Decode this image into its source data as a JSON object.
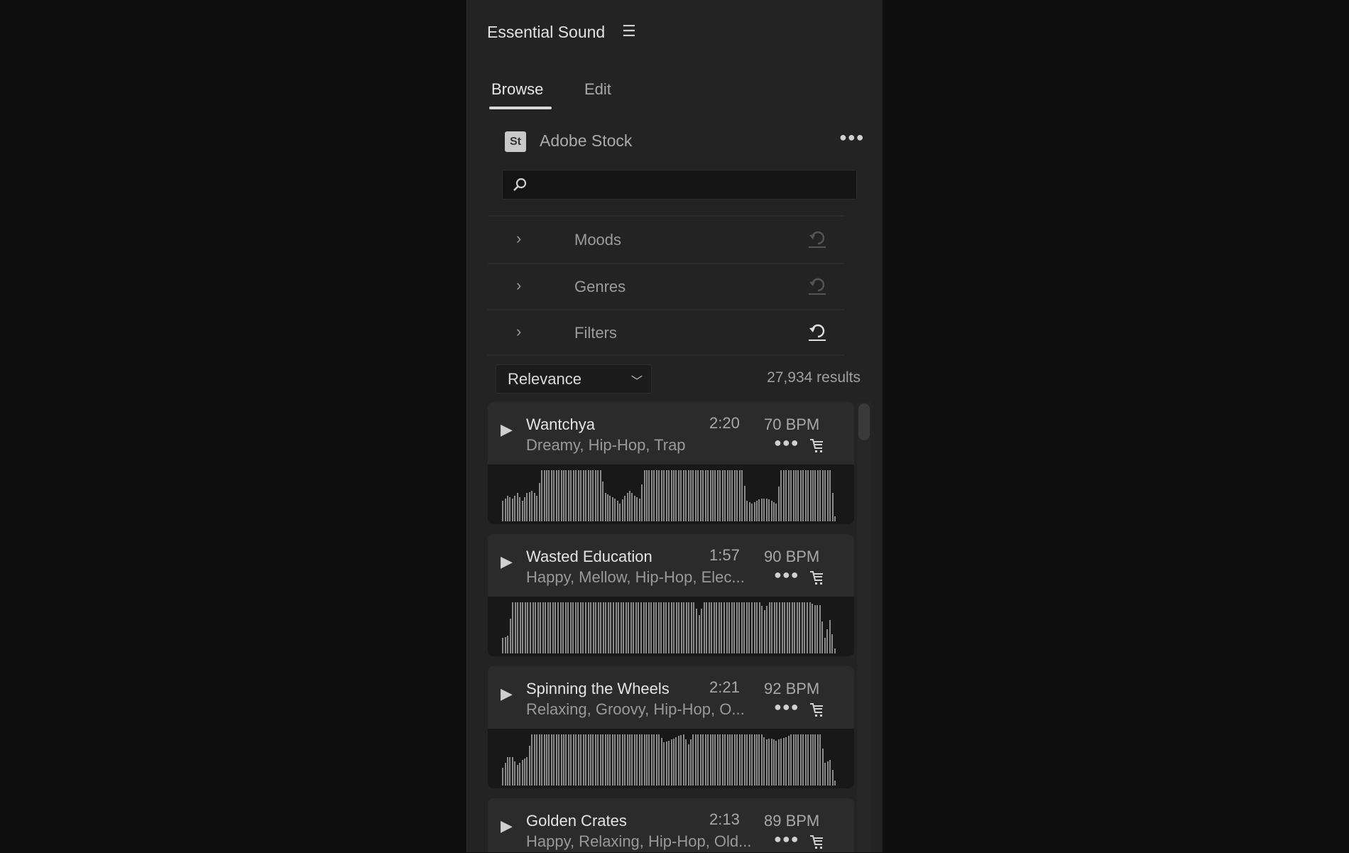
{
  "panel": {
    "title": "Essential Sound",
    "tabs": [
      "Browse",
      "Edit"
    ],
    "active_tab": "Browse"
  },
  "source": {
    "logo": "St",
    "label": "Adobe Stock"
  },
  "search": {
    "value": "",
    "placeholder": ""
  },
  "accordions": [
    {
      "label": "Moods",
      "reset_enabled": false
    },
    {
      "label": "Genres",
      "reset_enabled": false
    },
    {
      "label": "Filters",
      "reset_enabled": true
    }
  ],
  "sort": {
    "selected": "Relevance"
  },
  "results": "27,934 results",
  "tracks": [
    {
      "name": "Wantchya",
      "duration": "2:20",
      "bpm": "70 BPM",
      "tags": "Dreamy, Hip-Hop, Trap",
      "waveform": [
        0.4,
        0.5,
        0.45,
        0.55,
        0.4,
        0.55,
        0.6,
        0.5,
        1,
        1,
        1,
        1,
        1,
        1,
        1,
        1,
        1,
        1,
        1,
        1,
        1,
        0.55,
        0.5,
        0.45,
        0.35,
        0.5,
        0.6,
        0.5,
        0.45,
        1,
        1,
        1,
        1,
        1,
        1,
        1,
        1,
        1,
        1,
        1,
        1,
        1,
        1,
        1,
        1,
        1,
        1,
        1,
        1,
        1,
        0.4,
        0.35,
        0.4,
        0.45,
        0.45,
        0.4,
        0.35,
        1,
        1,
        1,
        1,
        1,
        1,
        1,
        1,
        1,
        1,
        1,
        0.1
      ]
    },
    {
      "name": "Wasted Education",
      "duration": "1:57",
      "bpm": "90 BPM",
      "tags": "Happy, Mellow, Hip-Hop, Elec...",
      "waveform": [
        0.3,
        0.35,
        1,
        1,
        1,
        1,
        1,
        1,
        1,
        1,
        1,
        1,
        1,
        1,
        1,
        1,
        1,
        1,
        1,
        1,
        1,
        1,
        1,
        1,
        1,
        1,
        1,
        1,
        1,
        1,
        1,
        1,
        1,
        1,
        1,
        1,
        1,
        1,
        1,
        0.75,
        1,
        1,
        1,
        1,
        1,
        1,
        1,
        1,
        1,
        1,
        1,
        1,
        0.85,
        1,
        1,
        1,
        1,
        1,
        1,
        1,
        1,
        1,
        0.95,
        0.95,
        0.3,
        0.65,
        0.1
      ]
    },
    {
      "name": "Spinning the Wheels",
      "duration": "2:21",
      "bpm": "92 BPM",
      "tags": "Relaxing, Groovy, Hip-Hop, O...",
      "waveform": [
        0.35,
        0.55,
        0.55,
        0.4,
        0.5,
        0.55,
        1,
        1,
        1,
        1,
        1,
        1,
        1,
        1,
        1,
        1,
        1,
        1,
        1,
        1,
        1,
        1,
        1,
        1,
        1,
        1,
        1,
        1,
        1,
        1,
        1,
        1,
        1,
        0.85,
        0.88,
        0.92,
        0.97,
        1,
        0.8,
        1,
        1,
        1,
        1,
        1,
        1,
        1,
        1,
        1,
        1,
        1,
        1,
        1,
        1,
        1,
        0.9,
        0.92,
        0.88,
        0.92,
        0.95,
        1,
        1,
        1,
        1,
        1,
        1,
        1,
        0.45,
        0.5,
        0.1
      ]
    },
    {
      "name": "Golden Crates",
      "duration": "2:13",
      "bpm": "89 BPM",
      "tags": "Happy, Relaxing, Hip-Hop, Old...",
      "waveform": []
    }
  ]
}
